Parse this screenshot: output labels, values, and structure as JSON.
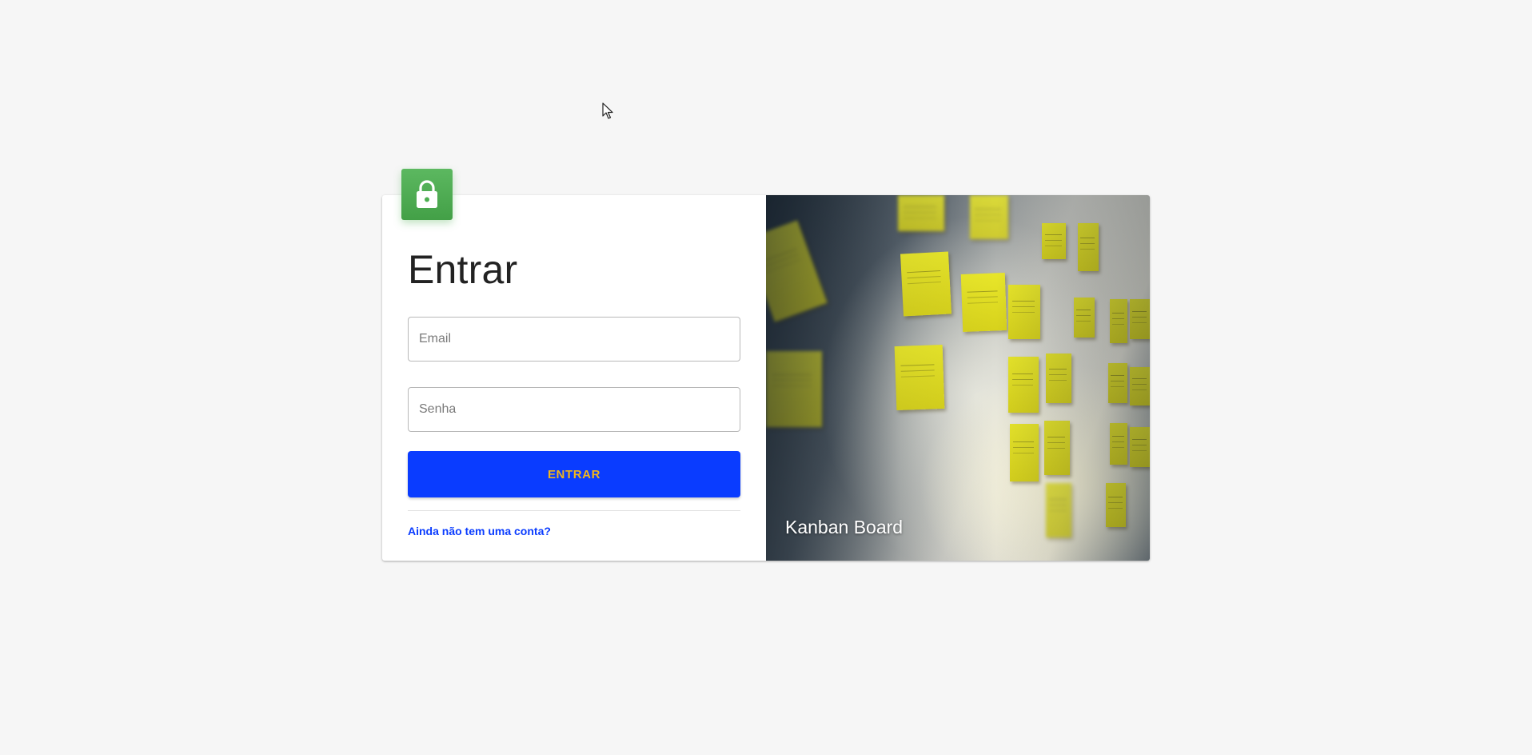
{
  "login": {
    "title": "Entrar",
    "email_placeholder": "Email",
    "password_placeholder": "Senha",
    "submit_label": "ENTRAR",
    "signup_link": "Ainda não tem uma conta?"
  },
  "image_panel": {
    "caption": "Kanban Board"
  },
  "icons": {
    "badge": "lock-icon"
  },
  "colors": {
    "background": "#f6f6f6",
    "badge_green": "#4caf50",
    "primary_blue": "#0a3cff",
    "button_text": "#f2b61a",
    "link": "#0a3cff"
  }
}
